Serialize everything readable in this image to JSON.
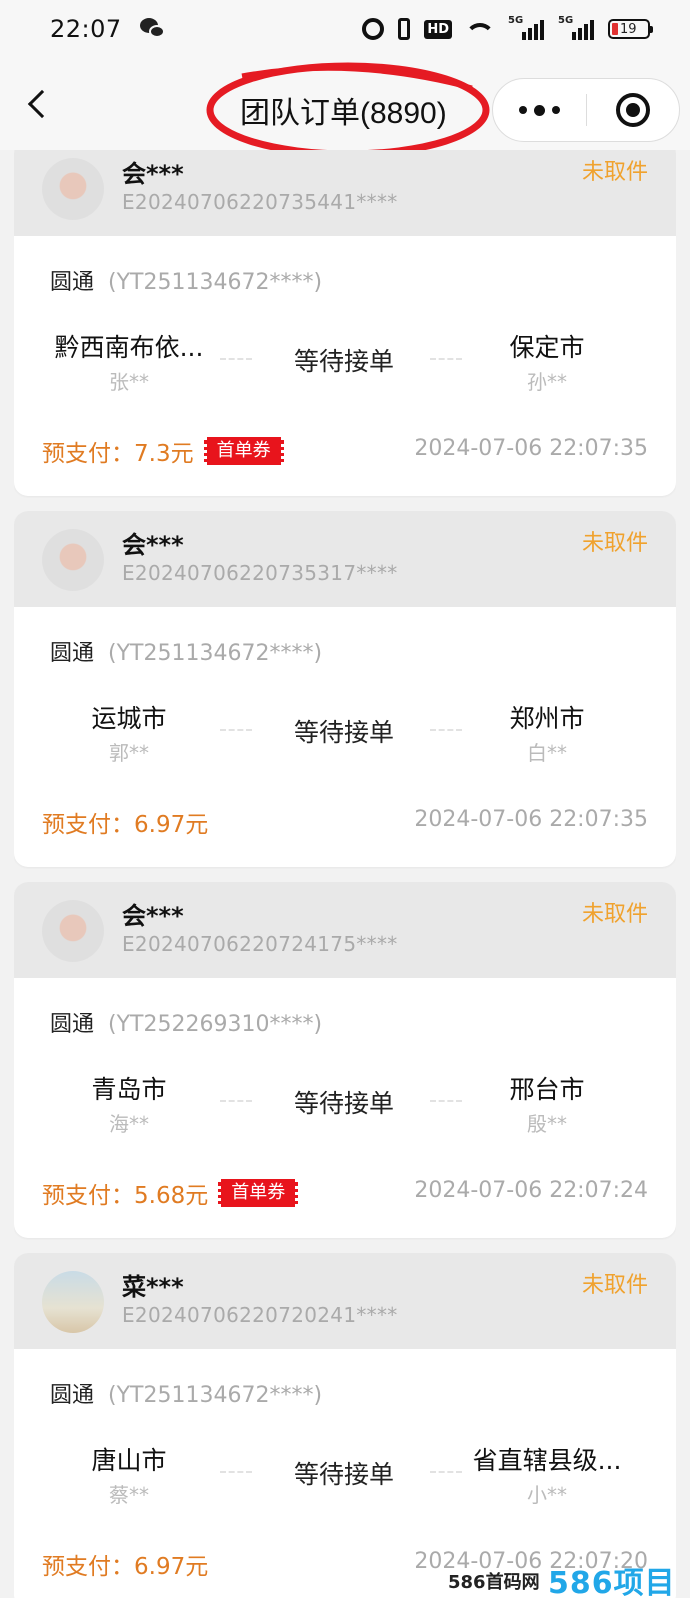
{
  "status_bar": {
    "time": "22:07",
    "battery": "19",
    "hd_label": "HD",
    "net_labels": [
      "5G",
      "5G"
    ]
  },
  "nav": {
    "title": "团队订单(8890)"
  },
  "orders": [
    {
      "user": "会***",
      "order_no": "E20240706220735441****",
      "status": "未取件",
      "carrier": "圆通",
      "tracking": "(YT251134672****)",
      "from_city": "黔西南布依...",
      "from_person": "张**",
      "route_status": "等待接单",
      "to_city": "保定市",
      "to_person": "孙**",
      "prepay": "预支付：7.3元",
      "coupon": "首单券",
      "time": "2024-07-06 22:07:35"
    },
    {
      "user": "会***",
      "order_no": "E20240706220735317****",
      "status": "未取件",
      "carrier": "圆通",
      "tracking": "(YT251134672****)",
      "from_city": "运城市",
      "from_person": "郭**",
      "route_status": "等待接单",
      "to_city": "郑州市",
      "to_person": "白**",
      "prepay": "预支付：6.97元",
      "coupon": "",
      "time": "2024-07-06 22:07:35"
    },
    {
      "user": "会***",
      "order_no": "E20240706220724175****",
      "status": "未取件",
      "carrier": "圆通",
      "tracking": "(YT252269310****)",
      "from_city": "青岛市",
      "from_person": "海**",
      "route_status": "等待接单",
      "to_city": "邢台市",
      "to_person": "殷**",
      "prepay": "预支付：5.68元",
      "coupon": "首单券",
      "time": "2024-07-06 22:07:24"
    },
    {
      "user": "菜***",
      "order_no": "E20240706220720241****",
      "status": "未取件",
      "carrier": "圆通",
      "tracking": "(YT251134672****)",
      "from_city": "唐山市",
      "from_person": "蔡**",
      "route_status": "等待接单",
      "to_city": "省直辖县级...",
      "to_person": "小**",
      "prepay": "预支付：6.97元",
      "coupon": "",
      "time": "2024-07-06 22:07:20"
    }
  ],
  "watermark": {
    "text": "586首码网",
    "logo": "586项目网"
  },
  "colors": {
    "accent_orange": "#e07b22",
    "status_yellow": "#f0a22e",
    "coupon_red": "#e8141c",
    "annotation_red": "#e51b23"
  }
}
